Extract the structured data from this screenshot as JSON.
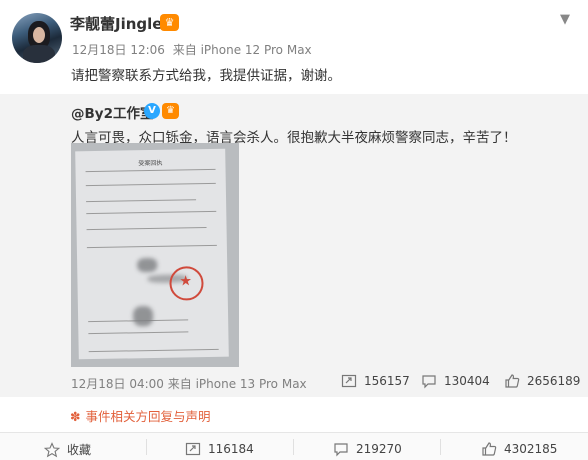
{
  "post": {
    "author": "李靓蕾Jinglei",
    "badge_icon": "crown-badge-icon",
    "date": "12月18日 12:06",
    "source": "来自 iPhone 12 Pro Max",
    "text": "请把警察联系方式给我，我提供证据，谢谢。"
  },
  "repost": {
    "author": "@By2工作室",
    "verified_icon": "verified-v-icon",
    "text": "人言可畏，众口铄金，语言会杀人。很抱歉大半夜麻烦警察同志，辛苦了！",
    "image": {
      "doc_title": "受案回执"
    },
    "date": "12月18日 04:00",
    "source": "来自 iPhone 13 Pro Max",
    "stats": {
      "forward": "156157",
      "comment": "130404",
      "like": "2656189"
    }
  },
  "notice": {
    "icon": "asterisk-flower-icon",
    "label": "事件相关方回复与声明"
  },
  "actions": {
    "favorite": "收藏",
    "forward": "116184",
    "comment": "219270",
    "like": "4302185"
  },
  "colors": {
    "repost_bg": "#f3f3f3",
    "meta_gray": "#808080",
    "notice_orange": "#e2603b",
    "verified_blue": "#2aa7ff",
    "crown_orange": "#ff8a00"
  }
}
